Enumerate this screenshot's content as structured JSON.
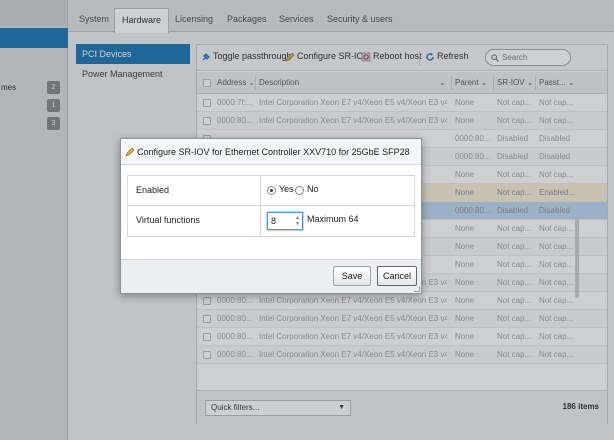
{
  "sidebar": {
    "label": "mes",
    "badges": [
      "2",
      "1",
      "3"
    ]
  },
  "tabs": [
    {
      "label": "System"
    },
    {
      "label": "Hardware",
      "active": true
    },
    {
      "label": "Licensing"
    },
    {
      "label": "Packages"
    },
    {
      "label": "Services"
    },
    {
      "label": "Security & users"
    }
  ],
  "subnav": [
    {
      "label": "PCI Devices",
      "active": true
    },
    {
      "label": "Power Management"
    }
  ],
  "toolbar": {
    "toggle_passthrough": "Toggle passthrough",
    "configure_sriov": "Configure SR-IOV",
    "reboot_host": "Reboot host",
    "refresh": "Refresh",
    "search_placeholder": "Search"
  },
  "columns": {
    "address": "Address",
    "description": "Description",
    "parent": "Parent",
    "sriov": "SR-IOV",
    "passthrough": "Passt..."
  },
  "rows": [
    {
      "address": "0000:7f:...",
      "description": "Intel Corporation Xeon E7 v4/Xeon E5 v4/Xeon E3 v4/Xe...",
      "parent": "None",
      "sriov": "Not cap...",
      "passthrough": "Not cap..."
    },
    {
      "address": "0000:80...",
      "description": "Intel Corporation Xeon E7 v4/Xeon E5 v4/Xeon E3 v4/Xe...",
      "parent": "None",
      "sriov": "Not cap...",
      "passthrough": "Not cap..."
    },
    {
      "address": "",
      "description": "",
      "parent": "0000:80...",
      "sriov": "Disabled",
      "passthrough": "Disabled"
    },
    {
      "address": "",
      "description": "",
      "parent": "0000:80...",
      "sriov": "Disabled",
      "passthrough": "Disabled"
    },
    {
      "address": "",
      "description": "/4/Xe...",
      "parent": "None",
      "sriov": "Not cap...",
      "passthrough": "Not cap..."
    },
    {
      "address": "",
      "description": "28",
      "parent": "None",
      "sriov": "Not cap...",
      "passthrough": "Enabled..."
    },
    {
      "address": "",
      "description": "28",
      "parent": "0000:80...",
      "sriov": "Disabled",
      "passthrough": "Disabled"
    },
    {
      "address": "",
      "description": "/4/Xe...",
      "parent": "None",
      "sriov": "Not cap...",
      "passthrough": "Not cap..."
    },
    {
      "address": "",
      "description": "/4/Xe...",
      "parent": "None",
      "sriov": "Not cap...",
      "passthrough": "Not cap..."
    },
    {
      "address": "",
      "description": "/4/Xe...",
      "parent": "None",
      "sriov": "Not cap...",
      "passthrough": "Not cap..."
    },
    {
      "address": "0000:80...",
      "description": "Intel Corporation Xeon E7 v4/Xeon E5 v4/Xeon E3 v4/Xe...",
      "parent": "None",
      "sriov": "Not cap...",
      "passthrough": "Not cap..."
    },
    {
      "address": "0000:80...",
      "description": "Intel Corporation Xeon E7 v4/Xeon E5 v4/Xeon E3 v4/Xe...",
      "parent": "None",
      "sriov": "Not cap...",
      "passthrough": "Not cap..."
    },
    {
      "address": "0000:80...",
      "description": "Intel Corporation Xeon E7 v4/Xeon E5 v4/Xeon E3 v4/Xe...",
      "parent": "None",
      "sriov": "Not cap...",
      "passthrough": "Not cap..."
    },
    {
      "address": "0000:80...",
      "description": "Intel Corporation Xeon E7 v4/Xeon E5 v4/Xeon E3 v4/Xe...",
      "parent": "None",
      "sriov": "Not cap...",
      "passthrough": "Not cap..."
    },
    {
      "address": "0000:80...",
      "description": "Intel Corporation Xeon E7 v4/Xeon E5 v4/Xeon E3 v4/Xe...",
      "parent": "None",
      "sriov": "Not cap...",
      "passthrough": "Not cap..."
    }
  ],
  "footer": {
    "quick_filters": "Quick filters...",
    "item_count": "186 items"
  },
  "dialog": {
    "title": "Configure SR-IOV for Ethernet Controller XXV710 for 25GbE SFP28",
    "enabled_label": "Enabled",
    "yes_label": "Yes",
    "no_label": "No",
    "vf_label": "Virtual functions",
    "vf_value": "8",
    "vf_max": "Maximum 64",
    "save_label": "Save",
    "cancel_label": "Cancel"
  },
  "colors": {
    "accent": "#0d6fb3",
    "selected_row": "#bad6f0",
    "highlight_row": "#f9ecd3"
  }
}
